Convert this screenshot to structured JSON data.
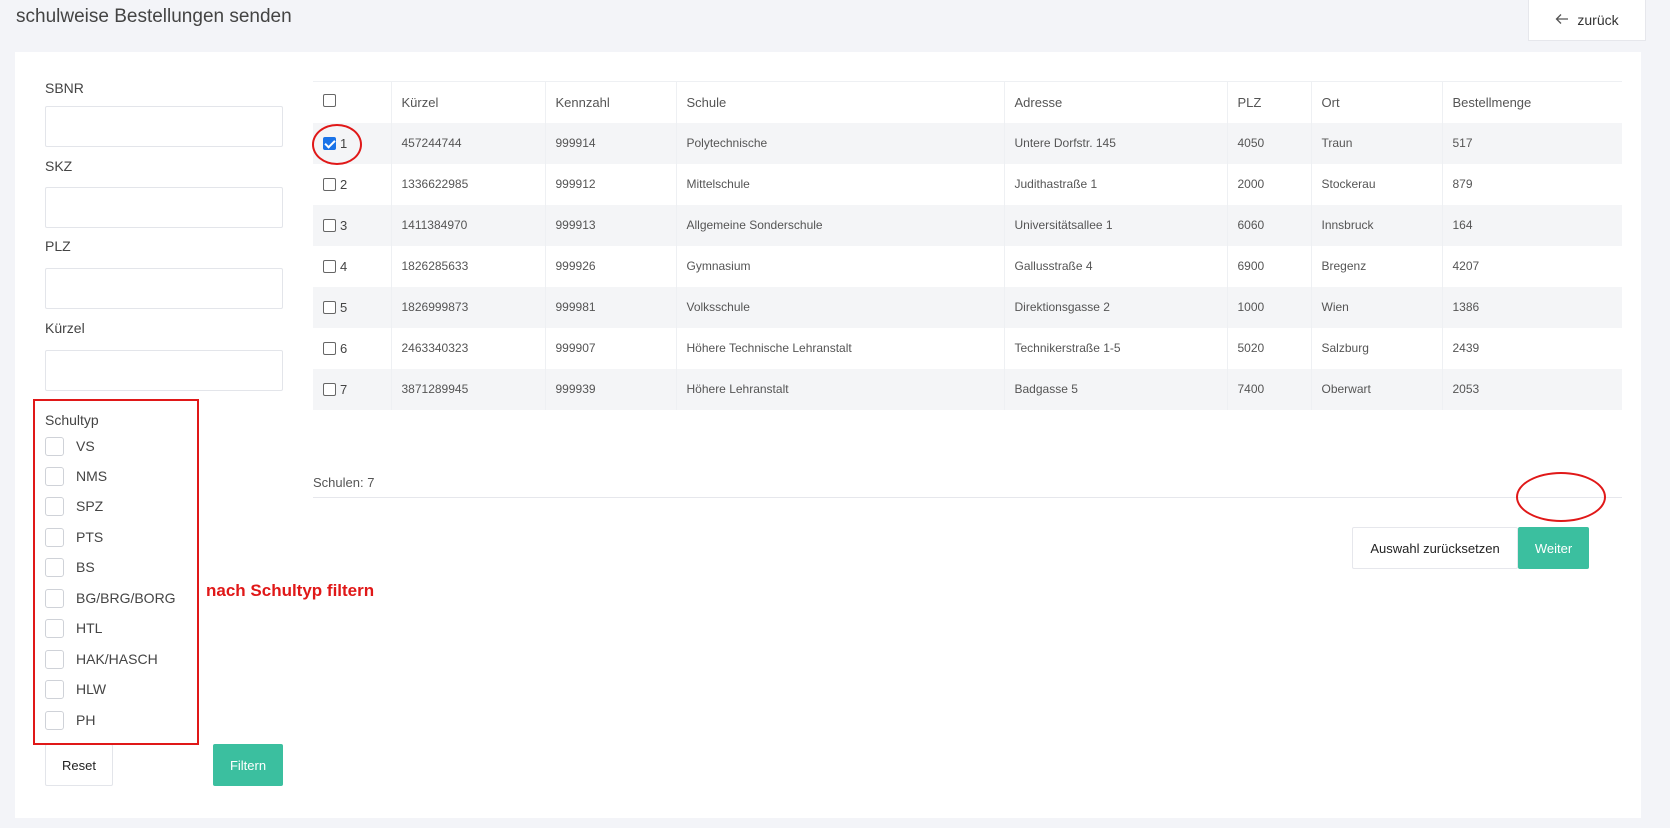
{
  "header": {
    "title": "schulweise Bestellungen senden",
    "back_label": "zurück"
  },
  "filters": {
    "fields": [
      {
        "label": "SBNR",
        "value": ""
      },
      {
        "label": "SKZ",
        "value": ""
      },
      {
        "label": "PLZ",
        "value": ""
      },
      {
        "label": "Kürzel",
        "value": ""
      }
    ],
    "schultyp_label": "Schultyp",
    "types": [
      "VS",
      "NMS",
      "SPZ",
      "PTS",
      "BS",
      "BG/BRG/BORG",
      "HTL",
      "HAK/HASCH",
      "HLW",
      "PH"
    ],
    "reset_label": "Reset",
    "filter_label": "Filtern"
  },
  "table": {
    "columns": [
      "Kürzel",
      "Kennzahl",
      "Schule",
      "Adresse",
      "PLZ",
      "Ort",
      "Bestellmenge"
    ],
    "rows": [
      {
        "num": "1",
        "checked": true,
        "cells": [
          "457244744",
          "999914",
          "Polytechnische",
          "Untere Dorfstr. 145",
          "4050",
          "Traun",
          "517"
        ]
      },
      {
        "num": "2",
        "checked": false,
        "cells": [
          "1336622985",
          "999912",
          "Mittelschule",
          "Judithastraße 1",
          "2000",
          "Stockerau",
          "879"
        ]
      },
      {
        "num": "3",
        "checked": false,
        "cells": [
          "1411384970",
          "999913",
          "Allgemeine Sonderschule",
          "Universitätsallee 1",
          "6060",
          "Innsbruck",
          "164"
        ]
      },
      {
        "num": "4",
        "checked": false,
        "cells": [
          "1826285633",
          "999926",
          "Gymnasium",
          "Gallusstraße 4",
          "6900",
          "Bregenz",
          "4207"
        ]
      },
      {
        "num": "5",
        "checked": false,
        "cells": [
          "1826999873",
          "999981",
          "Volksschule",
          "Direktionsgasse 2",
          "1000",
          "Wien",
          "1386"
        ]
      },
      {
        "num": "6",
        "checked": false,
        "cells": [
          "2463340323",
          "999907",
          "Höhere Technische Lehranstalt",
          "Technikerstraße 1-5",
          "5020",
          "Salzburg",
          "2439"
        ]
      },
      {
        "num": "7",
        "checked": false,
        "cells": [
          "3871289945",
          "999939",
          "Höhere Lehranstalt",
          "Badgasse 5",
          "7400",
          "Oberwart",
          "2053"
        ]
      }
    ],
    "count_text": "Schulen: 7"
  },
  "actions": {
    "clear_label": "Auswahl zurücksetzen",
    "next_label": "Weiter"
  },
  "annotation": {
    "text": "nach Schultyp filtern",
    "color": "#e01818"
  },
  "colors": {
    "accent": "#3bbf9f",
    "annotation": "#e01818"
  }
}
